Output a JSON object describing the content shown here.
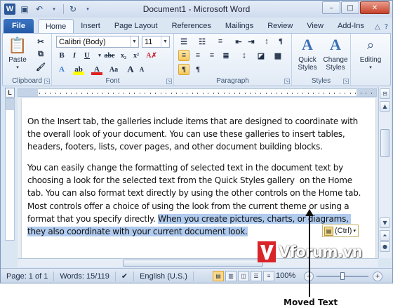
{
  "window": {
    "title": "Document1 - Microsoft Word",
    "app_icon_letter": "W",
    "controls": {
      "minimize": "–",
      "maximize": "□",
      "close": "✕"
    }
  },
  "qat": {
    "save_icon": "save-icon",
    "undo_icon": "undo-icon",
    "redo_icon": "repeat-icon"
  },
  "tabs": [
    "File",
    "Home",
    "Insert",
    "Page Layout",
    "References",
    "Mailings",
    "Review",
    "View",
    "Add-Ins"
  ],
  "active_tab": "Home",
  "ribbon": {
    "clipboard": {
      "paste_label": "Paste",
      "group_label": "Clipboard"
    },
    "font": {
      "font_name": "Calibri (Body)",
      "font_size": "11",
      "group_label": "Font"
    },
    "paragraph": {
      "group_label": "Paragraph"
    },
    "styles": {
      "quick_styles": "Quick Styles",
      "change_styles": "Change Styles",
      "group_label": "Styles"
    },
    "editing": {
      "label": "Editing"
    }
  },
  "document": {
    "para1": "On the Insert tab, the galleries include items that are designed to coordinate with the overall look of your document. You can use these galleries to insert tables, headers, footers, lists, cover pages, and other document building blocks.",
    "para2_plain": "You can easily change the formatting of selected text in the document text by choosing a look for the selected text from the Quick Styles gallery  on the Home tab. You can also format text directly by using the other controls on the Home tab. Most controls offer a choice of using the look from the current theme or using a format that you specify directly. ",
    "para2_selected": "When you create pictures, charts, or diagrams, they also coordinate with your current document look.",
    "paste_options_label": "(Ctrl)"
  },
  "status": {
    "page": "Page: 1 of 1",
    "words": "Words: 15/119",
    "language": "English (U.S.)",
    "zoom": "100%",
    "zoom_fraction": 0.5
  },
  "watermark": {
    "text": "Vforum.vn"
  },
  "annotation": {
    "caption": "Moved Text"
  }
}
